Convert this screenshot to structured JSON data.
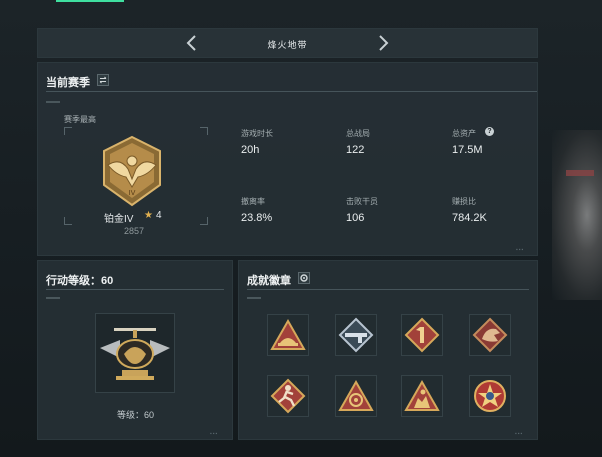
{
  "season_selector": {
    "title": "烽火地带"
  },
  "current_season": {
    "title": "当前赛季",
    "best_label": "赛季最高",
    "rank": {
      "name": "铂金IV",
      "stars": "4",
      "score": "2857",
      "emblem_numeral": "IV"
    },
    "stats": [
      {
        "label": "游戏时长",
        "value": "20h",
        "has_help": false
      },
      {
        "label": "总战局",
        "value": "122",
        "has_help": false
      },
      {
        "label": "总资产",
        "value": "17.5M",
        "has_help": true
      },
      {
        "label": "撤离率",
        "value": "23.8%",
        "has_help": false
      },
      {
        "label": "击败干员",
        "value": "106",
        "has_help": false
      },
      {
        "label": "赚损比",
        "value": "784.2K",
        "has_help": false
      }
    ]
  },
  "action_level": {
    "title": "行动等级：60",
    "level_text": "等级：60"
  },
  "achievements": {
    "title": "成就徽章",
    "badges": [
      {
        "icon": "hat-badge-icon"
      },
      {
        "icon": "weapon-badge-icon"
      },
      {
        "icon": "number-one-badge-icon"
      },
      {
        "icon": "dragon-badge-icon"
      },
      {
        "icon": "runner-badge-icon"
      },
      {
        "icon": "target-badge-icon"
      },
      {
        "icon": "soldier-badge-icon"
      },
      {
        "icon": "star-medal-badge-icon"
      }
    ]
  },
  "help_symbol": "?",
  "colors": {
    "accent_green": "#3fe0a0",
    "gold": "#c8a45a",
    "badge_red": "#a2413a"
  }
}
